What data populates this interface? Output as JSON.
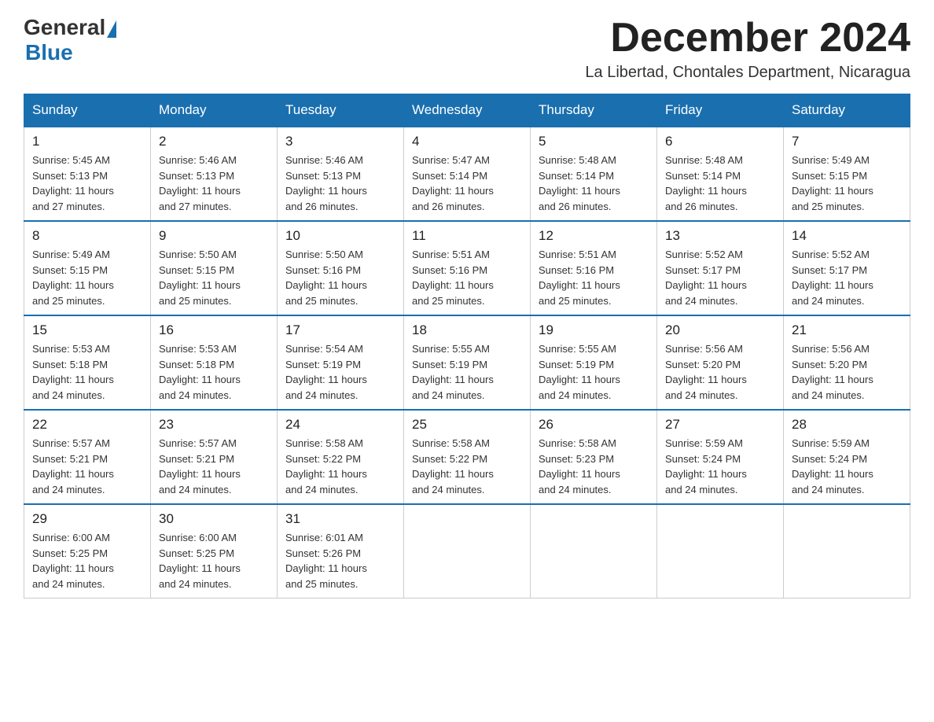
{
  "header": {
    "logo_general": "General",
    "logo_blue": "Blue",
    "month_title": "December 2024",
    "location": "La Libertad, Chontales Department, Nicaragua"
  },
  "calendar": {
    "days_of_week": [
      "Sunday",
      "Monday",
      "Tuesday",
      "Wednesday",
      "Thursday",
      "Friday",
      "Saturday"
    ],
    "weeks": [
      [
        {
          "day": "1",
          "sunrise": "5:45 AM",
          "sunset": "5:13 PM",
          "daylight": "11 hours and 27 minutes."
        },
        {
          "day": "2",
          "sunrise": "5:46 AM",
          "sunset": "5:13 PM",
          "daylight": "11 hours and 27 minutes."
        },
        {
          "day": "3",
          "sunrise": "5:46 AM",
          "sunset": "5:13 PM",
          "daylight": "11 hours and 26 minutes."
        },
        {
          "day": "4",
          "sunrise": "5:47 AM",
          "sunset": "5:14 PM",
          "daylight": "11 hours and 26 minutes."
        },
        {
          "day": "5",
          "sunrise": "5:48 AM",
          "sunset": "5:14 PM",
          "daylight": "11 hours and 26 minutes."
        },
        {
          "day": "6",
          "sunrise": "5:48 AM",
          "sunset": "5:14 PM",
          "daylight": "11 hours and 26 minutes."
        },
        {
          "day": "7",
          "sunrise": "5:49 AM",
          "sunset": "5:15 PM",
          "daylight": "11 hours and 25 minutes."
        }
      ],
      [
        {
          "day": "8",
          "sunrise": "5:49 AM",
          "sunset": "5:15 PM",
          "daylight": "11 hours and 25 minutes."
        },
        {
          "day": "9",
          "sunrise": "5:50 AM",
          "sunset": "5:15 PM",
          "daylight": "11 hours and 25 minutes."
        },
        {
          "day": "10",
          "sunrise": "5:50 AM",
          "sunset": "5:16 PM",
          "daylight": "11 hours and 25 minutes."
        },
        {
          "day": "11",
          "sunrise": "5:51 AM",
          "sunset": "5:16 PM",
          "daylight": "11 hours and 25 minutes."
        },
        {
          "day": "12",
          "sunrise": "5:51 AM",
          "sunset": "5:16 PM",
          "daylight": "11 hours and 25 minutes."
        },
        {
          "day": "13",
          "sunrise": "5:52 AM",
          "sunset": "5:17 PM",
          "daylight": "11 hours and 24 minutes."
        },
        {
          "day": "14",
          "sunrise": "5:52 AM",
          "sunset": "5:17 PM",
          "daylight": "11 hours and 24 minutes."
        }
      ],
      [
        {
          "day": "15",
          "sunrise": "5:53 AM",
          "sunset": "5:18 PM",
          "daylight": "11 hours and 24 minutes."
        },
        {
          "day": "16",
          "sunrise": "5:53 AM",
          "sunset": "5:18 PM",
          "daylight": "11 hours and 24 minutes."
        },
        {
          "day": "17",
          "sunrise": "5:54 AM",
          "sunset": "5:19 PM",
          "daylight": "11 hours and 24 minutes."
        },
        {
          "day": "18",
          "sunrise": "5:55 AM",
          "sunset": "5:19 PM",
          "daylight": "11 hours and 24 minutes."
        },
        {
          "day": "19",
          "sunrise": "5:55 AM",
          "sunset": "5:19 PM",
          "daylight": "11 hours and 24 minutes."
        },
        {
          "day": "20",
          "sunrise": "5:56 AM",
          "sunset": "5:20 PM",
          "daylight": "11 hours and 24 minutes."
        },
        {
          "day": "21",
          "sunrise": "5:56 AM",
          "sunset": "5:20 PM",
          "daylight": "11 hours and 24 minutes."
        }
      ],
      [
        {
          "day": "22",
          "sunrise": "5:57 AM",
          "sunset": "5:21 PM",
          "daylight": "11 hours and 24 minutes."
        },
        {
          "day": "23",
          "sunrise": "5:57 AM",
          "sunset": "5:21 PM",
          "daylight": "11 hours and 24 minutes."
        },
        {
          "day": "24",
          "sunrise": "5:58 AM",
          "sunset": "5:22 PM",
          "daylight": "11 hours and 24 minutes."
        },
        {
          "day": "25",
          "sunrise": "5:58 AM",
          "sunset": "5:22 PM",
          "daylight": "11 hours and 24 minutes."
        },
        {
          "day": "26",
          "sunrise": "5:58 AM",
          "sunset": "5:23 PM",
          "daylight": "11 hours and 24 minutes."
        },
        {
          "day": "27",
          "sunrise": "5:59 AM",
          "sunset": "5:24 PM",
          "daylight": "11 hours and 24 minutes."
        },
        {
          "day": "28",
          "sunrise": "5:59 AM",
          "sunset": "5:24 PM",
          "daylight": "11 hours and 24 minutes."
        }
      ],
      [
        {
          "day": "29",
          "sunrise": "6:00 AM",
          "sunset": "5:25 PM",
          "daylight": "11 hours and 24 minutes."
        },
        {
          "day": "30",
          "sunrise": "6:00 AM",
          "sunset": "5:25 PM",
          "daylight": "11 hours and 24 minutes."
        },
        {
          "day": "31",
          "sunrise": "6:01 AM",
          "sunset": "5:26 PM",
          "daylight": "11 hours and 25 minutes."
        },
        null,
        null,
        null,
        null
      ]
    ],
    "labels": {
      "sunrise": "Sunrise:",
      "sunset": "Sunset:",
      "daylight": "Daylight:"
    }
  }
}
